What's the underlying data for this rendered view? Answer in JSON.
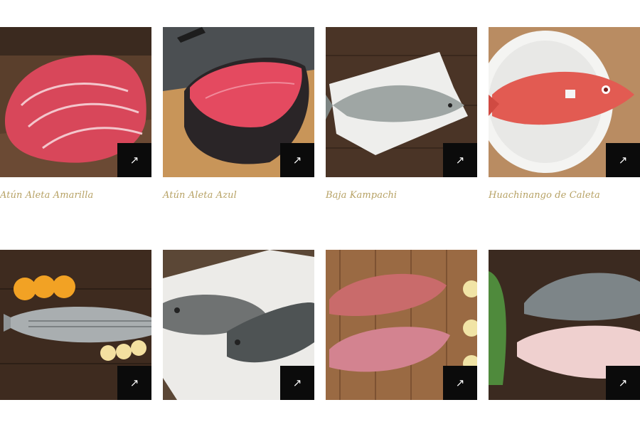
{
  "accent_color": "#b7a265",
  "button_color": "#0b0b0b",
  "products": [
    {
      "name": "Atún Aleta Amarilla",
      "icon": "arrow-up-right-icon",
      "arrow": "↗"
    },
    {
      "name": "Atún Aleta Azul",
      "icon": "arrow-up-right-icon",
      "arrow": "↗"
    },
    {
      "name": "Baja Kampachi",
      "icon": "arrow-up-right-icon",
      "arrow": "↗"
    },
    {
      "name": "Huachinango de Caleta",
      "icon": "arrow-up-right-icon",
      "arrow": "↗"
    },
    {
      "name": "",
      "icon": "arrow-up-right-icon",
      "arrow": "↗"
    },
    {
      "name": "",
      "icon": "arrow-up-right-icon",
      "arrow": "↗"
    },
    {
      "name": "",
      "icon": "arrow-up-right-icon",
      "arrow": "↗"
    },
    {
      "name": "",
      "icon": "arrow-up-right-icon",
      "arrow": "↗"
    }
  ]
}
